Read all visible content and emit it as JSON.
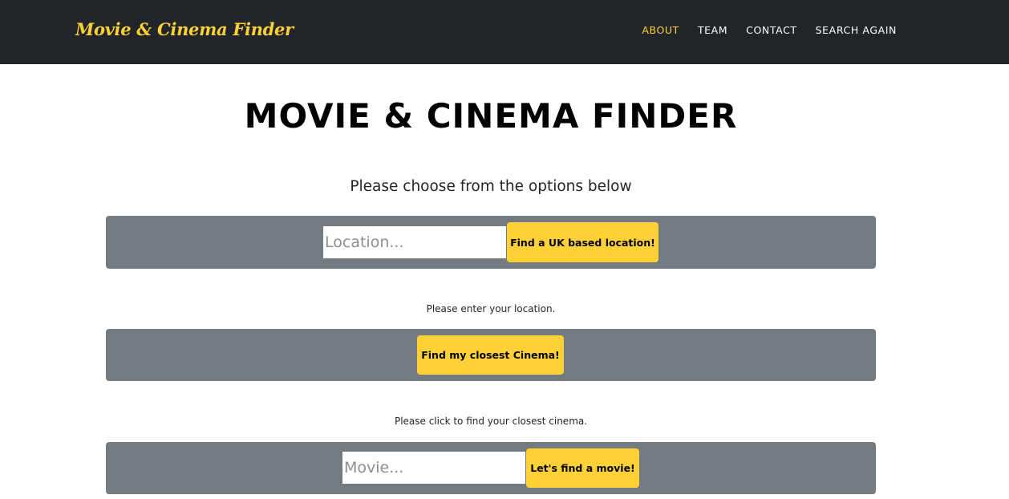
{
  "navbar": {
    "brand": "Movie & Cinema Finder",
    "links": [
      {
        "label": "ABOUT",
        "active": true
      },
      {
        "label": "TEAM",
        "active": false
      },
      {
        "label": "CONTACT",
        "active": false
      },
      {
        "label": "SEARCH AGAIN",
        "active": false
      }
    ]
  },
  "main": {
    "title": "MOVIE & CINEMA FINDER",
    "subtitle": "Please choose from the options below",
    "location_search": {
      "placeholder": "Location...",
      "value": "",
      "button_label": "Find a UK based location!",
      "help_text": "Please enter your location."
    },
    "closest_cinema": {
      "button_label": "Find my closest Cinema!",
      "help_text": "Please click to find your closest cinema."
    },
    "movie_search": {
      "placeholder": "Movie...",
      "value": "",
      "button_label": "Let's find a movie!"
    }
  },
  "colors": {
    "navbar_bg": "#212529",
    "accent": "#fed136",
    "panel_bg": "#737a80"
  }
}
